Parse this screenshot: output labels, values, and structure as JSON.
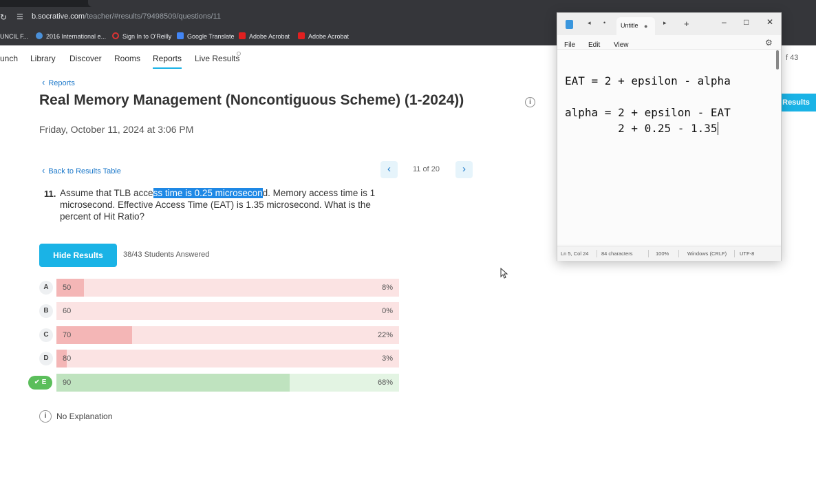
{
  "browser": {
    "url_host": "b.socrative.com",
    "url_path": "/teacher/#results/79498509/questions/11",
    "bookmarks": [
      {
        "label": "UNCIL F...",
        "icon": "folder-icon",
        "color": "#8ab4f8"
      },
      {
        "label": "2016 International e...",
        "icon": "globe-icon",
        "color": "#4a90d9"
      },
      {
        "label": "Sign In to O'Reilly",
        "icon": "oreilly-icon",
        "color": "#d33"
      },
      {
        "label": "Google Translate",
        "icon": "translate-icon",
        "color": "#4285f4"
      },
      {
        "label": "Adobe Acrobat",
        "icon": "acrobat-icon",
        "color": "#e02020"
      },
      {
        "label": "Adobe Acrobat",
        "icon": "acrobat-icon",
        "color": "#e02020"
      }
    ]
  },
  "nav": {
    "items": [
      "unch",
      "Library",
      "Discover",
      "Rooms",
      "Reports",
      "Live Results"
    ],
    "active": "Reports",
    "right_count": "f 43"
  },
  "report": {
    "back_label": "Reports",
    "title": "Real Memory Management (Noncontiguous Scheme) (1-2024))",
    "info_glyph": "i",
    "results_button": "Results",
    "date": "Friday, October 11, 2024 at 3:06 PM"
  },
  "question": {
    "back_table_label": "Back to Results Table",
    "pager": "11 of 20",
    "number": "11.",
    "text_before": "Assume that TLB acce",
    "text_highlight": "ss time is 0.25 microsecon",
    "text_after": "d. Memory access time is 1 microsecond. Effective Access Time (EAT) is 1.35 microsecond. What is the percent of Hit Ratio?",
    "hide_results_label": "Hide Results",
    "answered": "38/43 Students Answered",
    "answers": [
      {
        "letter": "A",
        "value": "50",
        "percent_label": "8%",
        "percent": 8,
        "correct": false
      },
      {
        "letter": "B",
        "value": "60",
        "percent_label": "0%",
        "percent": 0,
        "correct": false
      },
      {
        "letter": "C",
        "value": "70",
        "percent_label": "22%",
        "percent": 22,
        "correct": false
      },
      {
        "letter": "D",
        "value": "80",
        "percent_label": "3%",
        "percent": 3,
        "correct": false
      },
      {
        "letter": "E",
        "value": "90",
        "percent_label": "68%",
        "percent": 68,
        "correct": true
      }
    ],
    "explanation_glyph": "i",
    "explanation": "No Explanation"
  },
  "notepad": {
    "tab_title": "Untitle",
    "menu": [
      "File",
      "Edit",
      "View"
    ],
    "lines": [
      "EAT = 2 + epsilon - alpha",
      "",
      "alpha = 2 + epsilon - EAT",
      "        2 + 0.25 - 1.35"
    ],
    "status": {
      "position": "Ln 5, Col 24",
      "chars": "84 characters",
      "zoom": "100%",
      "line_ending": "Windows (CRLF)",
      "encoding": "UTF-8"
    }
  }
}
